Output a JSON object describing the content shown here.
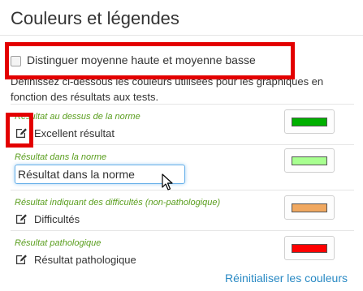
{
  "panel": {
    "title": "Couleurs et légendes",
    "distinguish_label": "Distinguer moyenne haute et moyenne basse",
    "description": "Définissez ci-dessous les couleurs utilisées pour les graphiques en fonction des résultats aux tests."
  },
  "rows": [
    {
      "category": "Résultat au dessus de la norme",
      "value": "Excellent résultat",
      "color": "#00b000"
    },
    {
      "category": "Résultat dans la norme",
      "value": "Résultat dans la norme",
      "color": "#a8ff90"
    },
    {
      "category": "Résultat indiquant des difficultés (non-pathologique)",
      "value": "Difficultés",
      "color": "#f0a860"
    },
    {
      "category": "Résultat pathologique",
      "value": "Résultat pathologique",
      "color": "#ff0000"
    }
  ],
  "reset_label": "Réinitialiser les couleurs",
  "colors": {
    "category_label": "#5a9e1e",
    "link": "#2a8ac4",
    "highlight": "#e30000"
  }
}
